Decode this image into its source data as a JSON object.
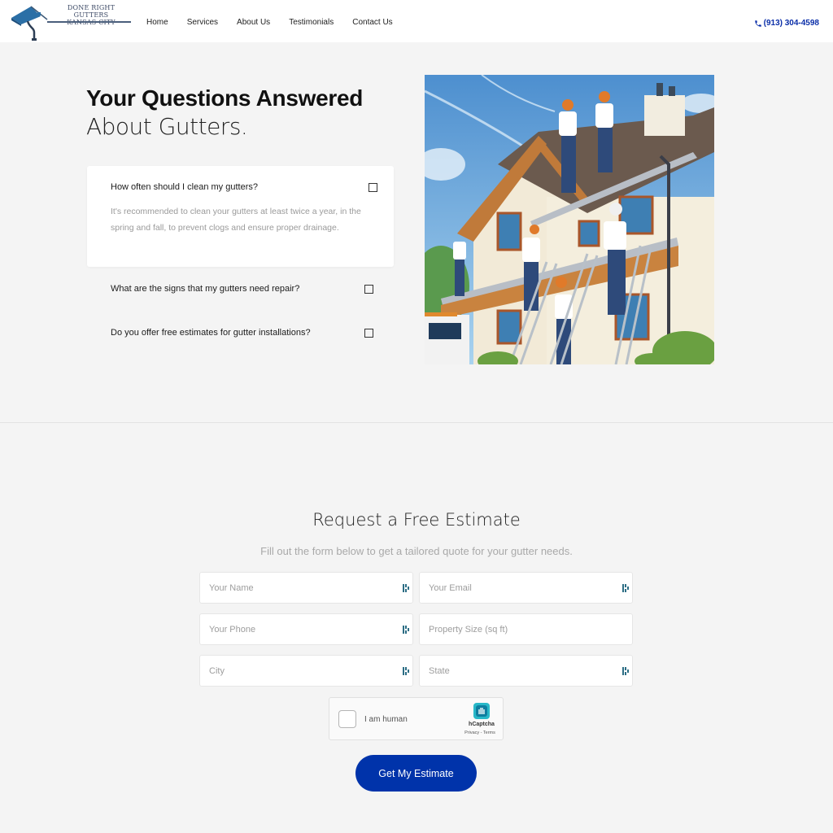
{
  "header": {
    "logo": {
      "line1": "DONE RIGHT GUTTERS",
      "line2": "KANSAS CITY"
    },
    "nav": [
      {
        "label": "Home"
      },
      {
        "label": "Services"
      },
      {
        "label": "About Us"
      },
      {
        "label": "Testimonials"
      },
      {
        "label": "Contact Us"
      }
    ],
    "phone": "(913) 304-4598",
    "phone_icon": "phone-icon"
  },
  "faq": {
    "title_bold": "Your Questions Answered",
    "title_light": "About Gutters.",
    "items": [
      {
        "question": "How often should I clean my gutters?",
        "answer": "It's recommended to clean your gutters at least twice a year, in the spring and fall, to prevent clogs and ensure proper drainage.",
        "expanded": true
      },
      {
        "question": "What are the signs that my gutters need repair?",
        "expanded": false
      },
      {
        "question": "Do you offer free estimates for gutter installations?",
        "expanded": false
      }
    ],
    "image_alt": "Workers installing gutters on a house roof"
  },
  "estimate": {
    "title": "Request a Free Estimate",
    "subtitle": "Fill out the form below to get a tailored quote for your gutter needs.",
    "fields": [
      {
        "placeholder": "Your Name",
        "value": ""
      },
      {
        "placeholder": "Your Email",
        "value": ""
      },
      {
        "placeholder": "Your Phone",
        "value": ""
      },
      {
        "placeholder": "Property Size (sq ft)",
        "value": ""
      },
      {
        "placeholder": "City",
        "value": ""
      },
      {
        "placeholder": "State",
        "value": ""
      }
    ],
    "captcha": {
      "label": "I am human",
      "brand": "hCaptcha",
      "links": "Privacy - Terms"
    },
    "submit_label": "Get My Estimate"
  },
  "colors": {
    "brand_blue": "#0033aa",
    "phone_blue": "#0a2ea8",
    "background": "#f4f4f4"
  }
}
